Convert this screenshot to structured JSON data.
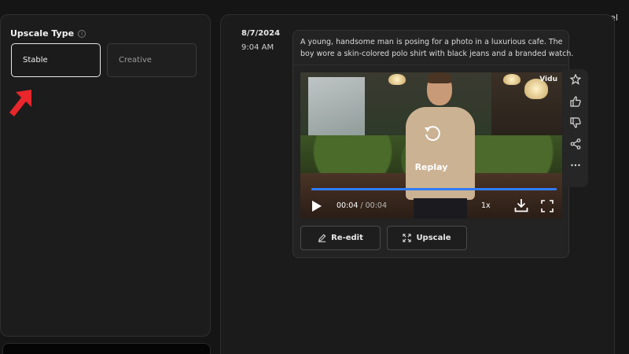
{
  "left_panel": {
    "cancel_label": "Cancel",
    "upscale_type_label": "Upscale Type",
    "options": [
      {
        "label": "Stable",
        "selected": true
      },
      {
        "label": "Creative",
        "selected": false
      }
    ]
  },
  "message": {
    "date": "8/7/2024",
    "time": "9:04 AM",
    "prompt": "A young, handsome man is posing for a photo in a luxurious cafe. The boy wore a skin-colored polo shirt with black jeans and a branded watch. The..."
  },
  "video": {
    "watermark": "Vidu",
    "replay_label": "Replay",
    "current_time": "00:04",
    "separator": " / ",
    "duration": "00:04",
    "speed": "1x",
    "progress": 1.0
  },
  "actions": {
    "reedit_label": "Re-edit",
    "upscale_label": "Upscale"
  },
  "side_actions": [
    "star-icon",
    "thumbs-up-icon",
    "thumbs-down-icon",
    "share-icon",
    "more-icon"
  ],
  "colors": {
    "background": "#151515",
    "panel": "#1c1c1c",
    "accent_progress": "#2f7cf6",
    "arrow": "#e8262b"
  }
}
